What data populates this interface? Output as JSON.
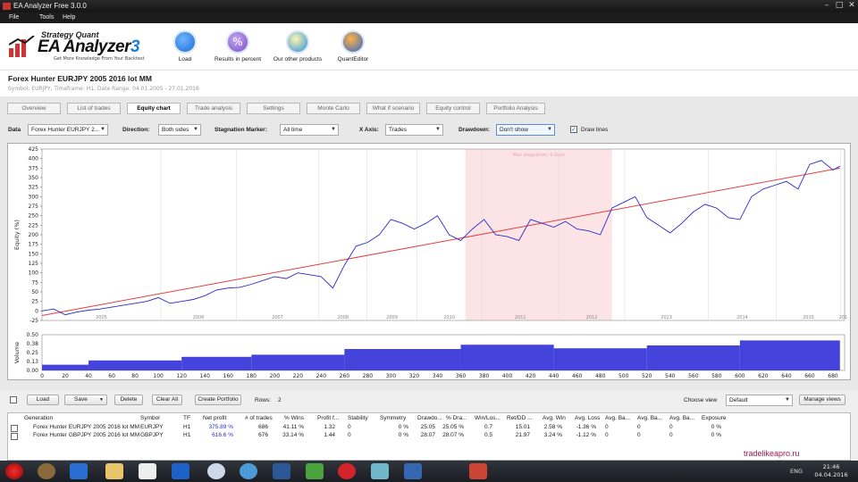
{
  "window": {
    "title": "EA Analyzer Free 3.0.0"
  },
  "menu": [
    "File",
    "Tools",
    "Help"
  ],
  "logo": {
    "brand_top": "Strategy Quant",
    "name": "EA Analyzer",
    "version": "3",
    "tagline": "Get More Knowledge From Your Backtest"
  },
  "toolbar": [
    {
      "label": "Load",
      "icon": "download-icon",
      "color": "#1b6fd1"
    },
    {
      "label": "Results in percent",
      "icon": "percent-icon",
      "color": "#7b4fc8"
    },
    {
      "label": "Our other products",
      "icon": "lightbulb-icon",
      "color": "#2a8ee0"
    },
    {
      "label": "QuantEditor",
      "icon": "quanteditor-icon",
      "color": "#2f66c9"
    }
  ],
  "strategy": {
    "title": "Forex Hunter EURJPY 2005 2016 lot MM",
    "subtitle": "Symbol: EURJPY, Timeframe: H1, Date Range: 04.01.2005 - 27.01.2016"
  },
  "tabs": [
    "Overview",
    "List of trades",
    "Equity chart",
    "Trade analysis",
    "Settings",
    "Monte Carlo",
    "What if scenario",
    "Equity control",
    "Portfolio Analysis"
  ],
  "active_tab": "Equity chart",
  "controls": {
    "data_label": "Data",
    "data_value": "Forex Hunter EURJPY 2...",
    "direction_label": "Direction:",
    "direction_value": "Both sides",
    "stagnation_label": "Stagnation Marker:",
    "stagnation_value": "All time",
    "xaxis_label": "X Axis:",
    "xaxis_value": "Trades",
    "drawdown_label": "Drawdown:",
    "drawdown_value": "Don't show",
    "drawlines_label": "Draw lines",
    "drawlines_checked": true
  },
  "chart_data": [
    {
      "type": "line",
      "ylabel": "Equity (%)",
      "ylim": [
        -25,
        425
      ],
      "yticks": [
        -25,
        0,
        25,
        50,
        75,
        100,
        125,
        150,
        175,
        200,
        225,
        250,
        275,
        300,
        325,
        350,
        375,
        400,
        425
      ],
      "year_labels": [
        "2005",
        "2006",
        "2007",
        "2008",
        "2009",
        "2010",
        "2011",
        "2012",
        "2013",
        "2014",
        "2015",
        "201"
      ],
      "stagnation_label": "Max stagnation: 0 days",
      "stagnation_range_trades": [
        364,
        490
      ],
      "x": [
        0,
        10,
        20,
        30,
        40,
        50,
        60,
        70,
        80,
        90,
        100,
        110,
        120,
        130,
        140,
        150,
        160,
        170,
        180,
        190,
        200,
        210,
        220,
        230,
        240,
        250,
        260,
        270,
        280,
        290,
        300,
        310,
        320,
        330,
        340,
        350,
        360,
        370,
        380,
        390,
        400,
        410,
        420,
        430,
        440,
        450,
        460,
        470,
        480,
        490,
        500,
        510,
        520,
        530,
        540,
        550,
        560,
        570,
        580,
        590,
        600,
        610,
        620,
        630,
        640,
        650,
        660,
        670,
        680,
        686
      ],
      "series": [
        {
          "values": [
            0,
            5,
            -10,
            -3,
            2,
            5,
            10,
            15,
            20,
            25,
            35,
            20,
            25,
            30,
            40,
            55,
            60,
            62,
            70,
            80,
            90,
            85,
            100,
            95,
            90,
            60,
            120,
            170,
            180,
            200,
            240,
            230,
            215,
            230,
            250,
            200,
            185,
            215,
            240,
            200,
            195,
            185,
            240,
            230,
            220,
            235,
            215,
            210,
            200,
            270,
            285,
            300,
            245,
            225,
            205,
            230,
            260,
            280,
            270,
            245,
            240,
            300,
            320,
            330,
            340,
            320,
            385,
            395,
            370,
            380
          ],
          "color": "#2a2acc"
        },
        {
          "values": [
            -12,
            375
          ],
          "x": [
            0,
            686
          ],
          "color": "#e04040"
        }
      ]
    },
    {
      "type": "bar",
      "ylabel": "Volume",
      "ylim": [
        0,
        0.5
      ],
      "yticks": [
        "0.00",
        "0.13",
        "0.25",
        "0.38",
        "0.50"
      ],
      "xticks": [
        0,
        20,
        40,
        60,
        80,
        100,
        120,
        140,
        160,
        180,
        200,
        220,
        240,
        260,
        280,
        300,
        320,
        340,
        360,
        380,
        400,
        420,
        440,
        460,
        480,
        500,
        520,
        540,
        560,
        580,
        600,
        620,
        640,
        660,
        680
      ],
      "segments": [
        [
          0,
          40,
          0.08
        ],
        [
          40,
          120,
          0.14
        ],
        [
          120,
          180,
          0.19
        ],
        [
          180,
          260,
          0.22
        ],
        [
          260,
          360,
          0.3
        ],
        [
          360,
          440,
          0.36
        ],
        [
          440,
          520,
          0.31
        ],
        [
          520,
          600,
          0.35
        ],
        [
          600,
          686,
          0.42
        ]
      ],
      "color": "#4444dd"
    }
  ],
  "bottom": {
    "buttons": [
      "Load",
      "Save",
      "Delete",
      "Clear All",
      "Create Portfolio"
    ],
    "rows_label": "Rows:",
    "rows_value": "2",
    "choose_view_label": "Choose view",
    "choose_view_value": "Default",
    "manage_views": "Manage views",
    "columns": [
      "Generation",
      "Symbol",
      "TF",
      "Net profit",
      "# of trades",
      "% Wins",
      "Profit f...",
      "Stability",
      "Symmetry",
      "Drawdo...",
      "% Dra...",
      "Win/Los...",
      "Ret/DD ...",
      "Avg. Win",
      "Avg. Loss",
      "Avg. Ba...",
      "Avg. Ba...",
      "Avg. Ba...",
      "Exposure"
    ],
    "rows": [
      [
        "Forex Hunter EURJPY 2005 2016 lot MM",
        "EURJPY",
        "H1",
        "375.89 %",
        "686",
        "41.11 %",
        "1.32",
        "0",
        "0 %",
        "25.05",
        "25.05 %",
        "0.7",
        "15.01",
        "2.58 %",
        "-1.36 %",
        "0",
        "0",
        "0",
        "0 %"
      ],
      [
        "Forex Hunter GBPJPY 2005 2016 lot MM",
        "GBPJPY",
        "H1",
        "616.6 %",
        "676",
        "33.14 %",
        "1.44",
        "0",
        "0 %",
        "28.07",
        "28.07 %",
        "0.5",
        "21.97",
        "3.24 %",
        "-1.12 %",
        "0",
        "0",
        "0",
        "0 %"
      ]
    ]
  },
  "watermark": "tradelikeapro.ru",
  "taskbar": {
    "lang": "ENG",
    "time": "21:46",
    "date": "04.04.2016"
  }
}
